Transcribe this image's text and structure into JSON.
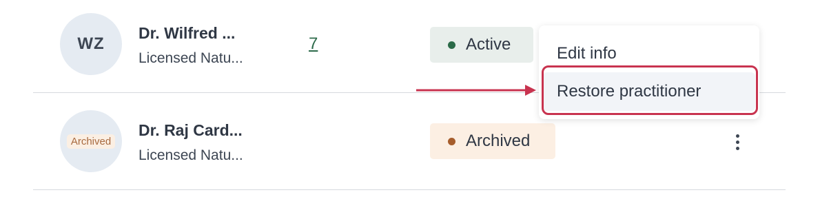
{
  "practitioners": [
    {
      "avatar_initials": "WZ",
      "name": "Dr. Wilfred ...",
      "subtitle": "Licensed Natu...",
      "count": "7",
      "status": "Active"
    },
    {
      "avatar_badge": "Archived",
      "name": "Dr. Raj Card...",
      "subtitle": "Licensed Natu...",
      "status": "Archived"
    }
  ],
  "menu": {
    "items": [
      "Edit info",
      "Restore practitioner"
    ]
  },
  "colors": {
    "active_badge_bg": "#e8eeeb",
    "active_dot": "#2b6a48",
    "archived_badge_bg": "#fcefe3",
    "archived_dot": "#a65d2c",
    "highlight": "#c8334f",
    "link": "#2c6a4a"
  },
  "icons": {
    "row_menu": "kebab-vertical-icon",
    "annotation": "arrow-right-icon"
  }
}
